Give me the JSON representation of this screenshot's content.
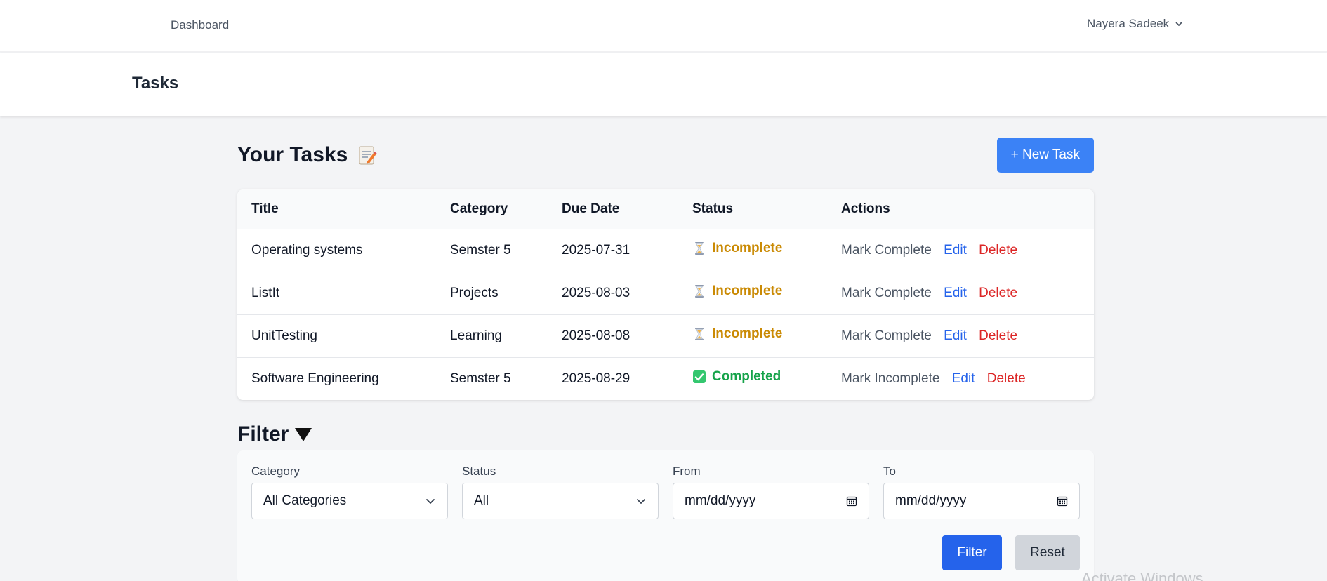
{
  "nav": {
    "dashboard_label": "Dashboard",
    "user_name": "Nayera Sadeek"
  },
  "header": {
    "title": "Tasks"
  },
  "tasks_section": {
    "heading": "Your Tasks",
    "heading_icon": "memo-icon",
    "new_task_label": "+ New Task",
    "columns": [
      "Title",
      "Category",
      "Due Date",
      "Status",
      "Actions"
    ],
    "rows": [
      {
        "title": "Operating systems",
        "category": "Semster 5",
        "due_date": "2025-07-31",
        "status": "Incomplete",
        "status_icon": "hourglass-icon",
        "toggle_label": "Mark Complete",
        "edit_label": "Edit",
        "delete_label": "Delete"
      },
      {
        "title": "ListIt",
        "category": "Projects",
        "due_date": "2025-08-03",
        "status": "Incomplete",
        "status_icon": "hourglass-icon",
        "toggle_label": "Mark Complete",
        "edit_label": "Edit",
        "delete_label": "Delete"
      },
      {
        "title": "UnitTesting",
        "category": "Learning",
        "due_date": "2025-08-08",
        "status": "Incomplete",
        "status_icon": "hourglass-icon",
        "toggle_label": "Mark Complete",
        "edit_label": "Edit",
        "delete_label": "Delete"
      },
      {
        "title": "Software Engineering",
        "category": "Semster 5",
        "due_date": "2025-08-29",
        "status": "Completed",
        "status_icon": "check-mark-icon",
        "toggle_label": "Mark Incomplete",
        "edit_label": "Edit",
        "delete_label": "Delete"
      }
    ]
  },
  "filter": {
    "heading": "Filter",
    "heading_icon": "triangle-down-icon",
    "category_label": "Category",
    "category_value": "All Categories",
    "status_label": "Status",
    "status_value": "All",
    "from_label": "From",
    "from_placeholder": "mm/dd/yyyy",
    "to_label": "To",
    "to_placeholder": "mm/dd/yyyy",
    "filter_button": "Filter",
    "reset_button": "Reset"
  },
  "watermark": "Activate Windows",
  "colors": {
    "primary": "#3b82f6",
    "primary_dark": "#2563eb",
    "incomplete": "#ca8a04",
    "completed": "#16a34a",
    "delete": "#dc2626",
    "background": "#f3f4f6"
  }
}
